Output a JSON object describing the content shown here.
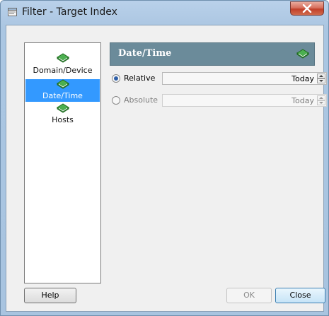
{
  "window": {
    "title": "Filter - Target Index"
  },
  "nav": {
    "items": [
      {
        "label": "Domain/Device",
        "selected": false
      },
      {
        "label": "Date/Time",
        "selected": true
      },
      {
        "label": "Hosts",
        "selected": false
      }
    ]
  },
  "panel": {
    "title": "Date/Time",
    "options": [
      {
        "label": "Relative",
        "selected": true,
        "value": "Today",
        "enabled": true
      },
      {
        "label": "Absolute",
        "selected": false,
        "value": "Today",
        "enabled": false
      }
    ]
  },
  "buttons": {
    "help": "Help",
    "ok": "OK",
    "close": "Close"
  },
  "colors": {
    "header_bg": "#6b8b9a",
    "selection": "#3399ff",
    "book_green": "#3f9d3f"
  }
}
